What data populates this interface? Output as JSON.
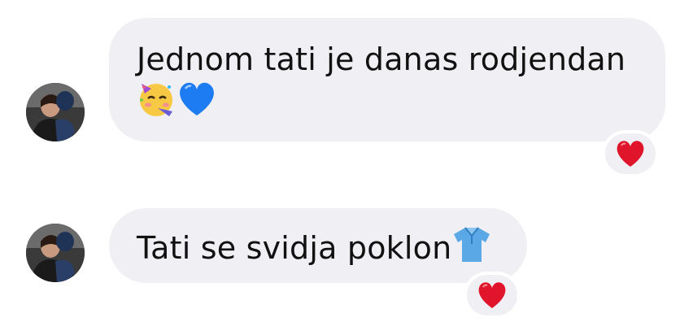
{
  "messages": [
    {
      "sender_avatar": "avatar-photo",
      "text_line1": "Jednom tati je danas rodjendan",
      "emojis": [
        "partying-face-emoji",
        "blue-heart-emoji"
      ],
      "reaction": "red-heart-emoji"
    },
    {
      "sender_avatar": "avatar-photo",
      "text": "Tati se svidja poklon",
      "emojis": [
        "tshirt-emoji"
      ],
      "reaction": "red-heart-emoji"
    }
  ],
  "colors": {
    "bubble_bg": "#f0f0f4",
    "text": "#111111",
    "heart_red": "#e0142a",
    "heart_blue": "#1e7cf2",
    "shirt_blue": "#5aa9e6"
  }
}
